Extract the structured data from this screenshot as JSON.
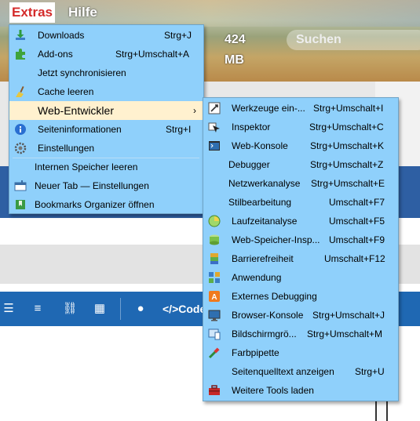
{
  "menubar": {
    "extras": "Extras",
    "hilfe": "Hilfe"
  },
  "toolbar": {
    "memory": "424 MB",
    "search_placeholder": "Suchen"
  },
  "editor_toolbar": {
    "code_label": "</>Code"
  },
  "extras_menu": {
    "items": [
      {
        "label": "Downloads",
        "shortcut": "Strg+J",
        "icon": "download-icon"
      },
      {
        "label": "Add-ons",
        "shortcut": "Strg+Umschalt+A",
        "icon": "puzzle-icon"
      },
      {
        "label": "Jetzt synchronisieren",
        "shortcut": "",
        "icon": ""
      },
      {
        "label": "Cache leeren",
        "shortcut": "",
        "icon": "broom-icon"
      },
      {
        "label": "Web-Entwickler",
        "shortcut": "",
        "icon": "",
        "submenu": true
      },
      {
        "label": "Seiteninformationen",
        "shortcut": "Strg+I",
        "icon": "info-icon"
      },
      {
        "label": "Einstellungen",
        "shortcut": "",
        "icon": "gear-icon"
      },
      {
        "label": "Internen Speicher leeren",
        "shortcut": "",
        "icon": ""
      },
      {
        "label": "Neuer Tab — Einstellungen",
        "shortcut": "",
        "icon": "new-tab-settings-icon"
      },
      {
        "label": "Bookmarks Organizer öffnen",
        "shortcut": "",
        "icon": "bookmark-icon"
      }
    ]
  },
  "dev_menu": {
    "items": [
      {
        "label": "Werkzeuge ein-...",
        "shortcut": "Strg+Umschalt+I",
        "icon": "toolbox-toggle-icon"
      },
      {
        "label": "Inspektor",
        "shortcut": "Strg+Umschalt+C",
        "icon": "inspector-icon"
      },
      {
        "label": "Web-Konsole",
        "shortcut": "Strg+Umschalt+K",
        "icon": "console-icon"
      },
      {
        "label": "Debugger",
        "shortcut": "Strg+Umschalt+Z",
        "icon": ""
      },
      {
        "label": "Netzwerkanalyse",
        "shortcut": "Strg+Umschalt+E",
        "icon": ""
      },
      {
        "label": "Stilbearbeitung",
        "shortcut": "Umschalt+F7",
        "icon": ""
      },
      {
        "label": "Laufzeitanalyse",
        "shortcut": "Umschalt+F5",
        "icon": "performance-icon"
      },
      {
        "label": "Web-Speicher-Insp...",
        "shortcut": "Umschalt+F9",
        "icon": "storage-icon"
      },
      {
        "label": "Barrierefreiheit",
        "shortcut": "Umschalt+F12",
        "icon": "accessibility-icon"
      },
      {
        "label": "Anwendung",
        "shortcut": "",
        "icon": "application-icon"
      },
      {
        "label": "Externes Debugging",
        "shortcut": "",
        "icon": "remote-debug-icon"
      },
      {
        "label": "Browser-Konsole",
        "shortcut": "Strg+Umschalt+J",
        "icon": "browser-console-icon"
      },
      {
        "label": "Bildschirmgrö...",
        "shortcut": "Strg+Umschalt+M",
        "icon": "responsive-icon"
      },
      {
        "label": "Farbpipette",
        "shortcut": "",
        "icon": "eyedropper-icon"
      },
      {
        "label": "Seitenquelltext anzeigen",
        "shortcut": "Strg+U",
        "icon": ""
      },
      {
        "label": "Weitere Tools laden",
        "shortcut": "",
        "icon": "toolbox-icon"
      }
    ]
  },
  "colors": {
    "menu_bg": "#8fd0fb",
    "highlight": "#fff1cf",
    "extras_red": "#d42b2b",
    "editor_blue": "#1f68b3"
  }
}
